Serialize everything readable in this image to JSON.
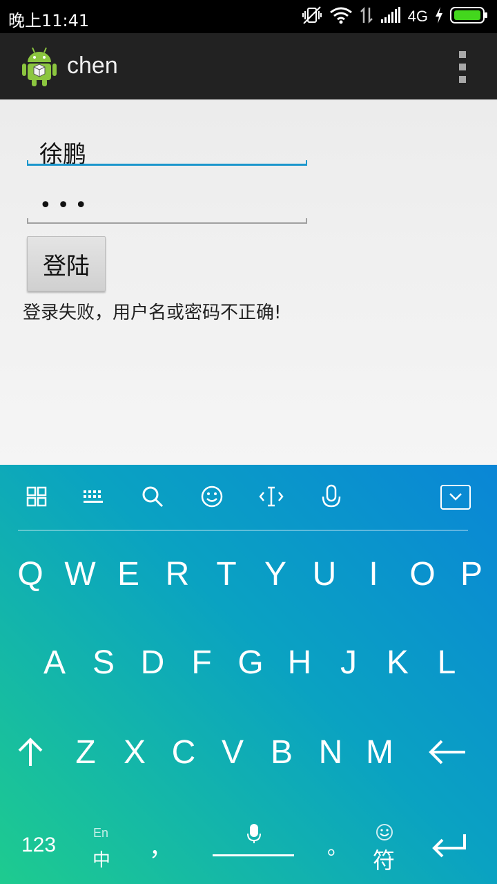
{
  "status_bar": {
    "time": "晚上11:41",
    "network": "4G",
    "battery_color": "#43d71d"
  },
  "action_bar": {
    "title": "chen",
    "app_icon": "android-robot-icon",
    "overflow_icon": "overflow-menu-icon"
  },
  "form": {
    "username_value": "徐鹏",
    "password_value": "•••",
    "login_label": "登陆",
    "error_message": "登录失败，用户名或密码不正确!"
  },
  "keyboard": {
    "toolbar_icons": [
      "grid-icon",
      "keyboard-icon",
      "search-icon",
      "emoji-icon",
      "cursor-icon",
      "microphone-icon",
      "hide-keyboard-icon"
    ],
    "row1": [
      "Q",
      "W",
      "E",
      "R",
      "T",
      "Y",
      "U",
      "I",
      "O",
      "P"
    ],
    "row2": [
      "A",
      "S",
      "D",
      "F",
      "G",
      "H",
      "J",
      "K",
      "L"
    ],
    "row3": [
      "Z",
      "X",
      "C",
      "V",
      "B",
      "N",
      "M"
    ],
    "numbers_label": "123",
    "lang_en_label": "En",
    "lang_zh_label": "中",
    "comma_label": "，",
    "period_label": "。",
    "symbols_label": "符",
    "accent_gradient": [
      "#0a86d6",
      "#1ecb8f"
    ]
  }
}
